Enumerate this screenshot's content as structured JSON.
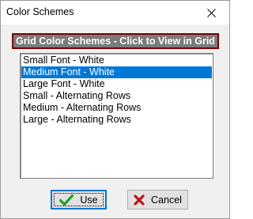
{
  "window": {
    "title": "Color Schemes"
  },
  "header": {
    "text": "Grid Color Schemes - Click to View in Grid",
    "bg_color": "#7b7b7b",
    "border_color": "#7a0000"
  },
  "schemes": {
    "items": [
      {
        "label": "Small Font - White",
        "selected": false
      },
      {
        "label": "Medium Font - White",
        "selected": true
      },
      {
        "label": "Large Font - White",
        "selected": false
      },
      {
        "label": "Small - Alternating Rows",
        "selected": false
      },
      {
        "label": "Medium - Alternating Rows",
        "selected": false
      },
      {
        "label": "Large - Alternating Rows",
        "selected": false
      }
    ],
    "selection_color": "#0078d7"
  },
  "buttons": {
    "use_label": "Use",
    "use_icon": "green-checkmark-icon",
    "cancel_label": "Cancel",
    "cancel_icon": "red-x-icon"
  }
}
